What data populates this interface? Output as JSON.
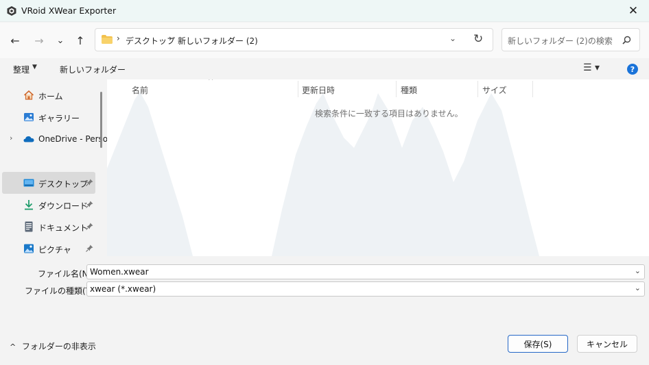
{
  "window": {
    "title": "VRoid XWear Exporter",
    "close_glyph": "✕"
  },
  "nav": {
    "back_glyph": "←",
    "forward_glyph": "→",
    "recent_glyph": "⌄",
    "up_glyph": "↑",
    "breadcrumb": [
      "デスクトップ",
      "新しいフォルダー (2)"
    ],
    "breadcrumb_sep": "›",
    "dropdown_glyph": "⌄",
    "refresh_glyph": "↻",
    "search_placeholder": "新しいフォルダー (2)の検索"
  },
  "toolbar": {
    "organize_label": "整理",
    "caret": "▼",
    "new_folder_label": "新しいフォルダー",
    "view_glyph": "☰ ▾",
    "help_glyph": "?"
  },
  "sidebar": {
    "items": [
      {
        "label": "ホーム",
        "icon": "home-icon"
      },
      {
        "label": "ギャラリー",
        "icon": "gallery-icon"
      },
      {
        "label": "OneDrive - Perso",
        "icon": "onedrive-icon",
        "expand": "›"
      },
      {
        "label": "デスクトップ",
        "icon": "desktop-icon",
        "selected": true
      },
      {
        "label": "ダウンロード",
        "icon": "download-icon"
      },
      {
        "label": "ドキュメント",
        "icon": "documents-icon"
      },
      {
        "label": "ピクチャ",
        "icon": "pictures-icon"
      }
    ]
  },
  "filelist": {
    "columns": [
      "名前",
      "更新日時",
      "種類",
      "サイズ"
    ],
    "sort_caret": "^",
    "empty_message": "検索条件に一致する項目はありません。"
  },
  "form": {
    "filename_label": "ファイル名(N):",
    "filename_value": "Women.xwear",
    "filetype_label": "ファイルの種類(T):",
    "filetype_value": "xwear (*.xwear)",
    "dropdown_glyph": "⌄"
  },
  "footer": {
    "hide_folders_label": "フォルダーの非表示",
    "hide_caret": "^",
    "save_label": "保存(S)",
    "cancel_label": "キャンセル"
  },
  "colors": {
    "accent": "#2366c6",
    "help": "#1a73d9",
    "titlebar": "#eef7f6",
    "folder": "#f2c14e"
  }
}
